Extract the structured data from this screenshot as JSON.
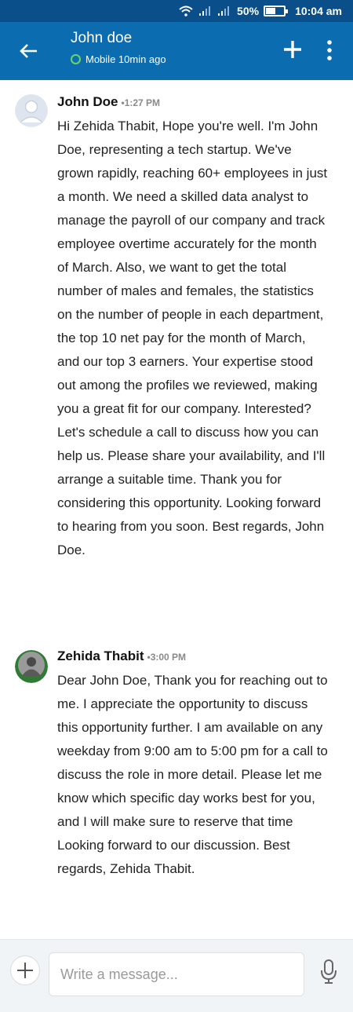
{
  "status_bar": {
    "battery_percent": "50%",
    "battery_level": 0.5,
    "time": "10:04 am",
    "icons": [
      "wifi-icon",
      "signal-icon",
      "signal-icon",
      "battery-icon"
    ]
  },
  "header": {
    "title": "John doe",
    "presence": "Mobile 10min ago",
    "presence_color": "#6ad36a",
    "bar_color": "#0b6db0"
  },
  "messages": [
    {
      "sender": "John Doe",
      "time": "•1:27 PM",
      "text": "Hi Zehida Thabit, Hope you're well. I'm John Doe, representing a tech startup. We've grown rapidly, reaching 60+ employees in just a month. We need a skilled data analyst to manage the payroll of our company and track employee overtime accurately for the month of March. Also, we want to get the total number of males and females, the statistics on the number of people in each department, the top 10 net pay for the month of March, and our top 3 earners. Your expertise stood out among the profiles we reviewed, making you a great fit for our company. Interested? Let's schedule a call to discuss how you can help us. Please share your availability, and I'll arrange a suitable time. Thank you for considering this opportunity. Looking forward to hearing from you soon. Best regards, John Doe."
    },
    {
      "sender": "Zehida Thabit",
      "time": "•3:00 PM",
      "text": "Dear John Doe, Thank you for reaching out to me. I appreciate the opportunity to discuss this opportunity further. I am available on any weekday from 9:00 am to 5:00 pm for a call to discuss the role in more detail. Please let me know which specific day works best for you, and I will make sure to reserve that time Looking forward to our discussion. Best regards, Zehida Thabit."
    }
  ],
  "composer": {
    "placeholder": "Write a message..."
  }
}
